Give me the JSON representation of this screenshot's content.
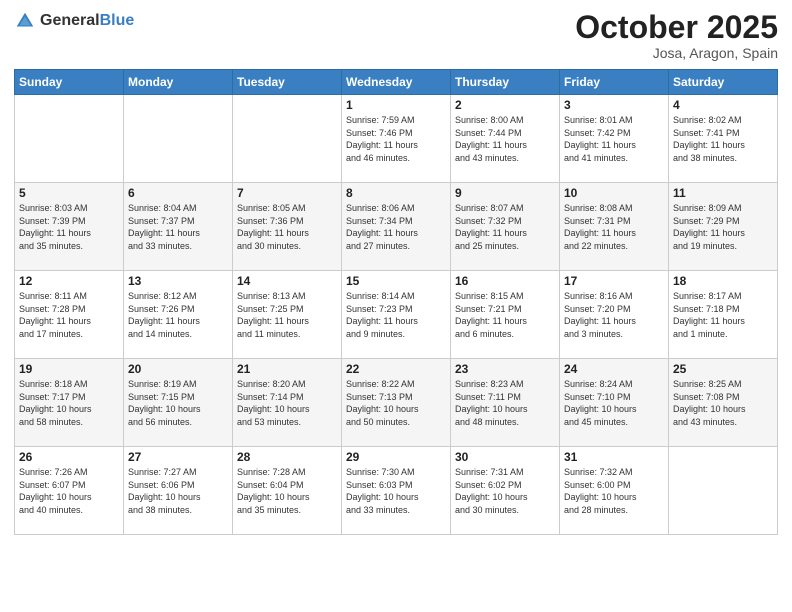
{
  "header": {
    "logo_general": "General",
    "logo_blue": "Blue",
    "month_title": "October 2025",
    "location": "Josa, Aragon, Spain"
  },
  "days_of_week": [
    "Sunday",
    "Monday",
    "Tuesday",
    "Wednesday",
    "Thursday",
    "Friday",
    "Saturday"
  ],
  "weeks": [
    [
      {
        "day": "",
        "info": ""
      },
      {
        "day": "",
        "info": ""
      },
      {
        "day": "",
        "info": ""
      },
      {
        "day": "1",
        "info": "Sunrise: 7:59 AM\nSunset: 7:46 PM\nDaylight: 11 hours\nand 46 minutes."
      },
      {
        "day": "2",
        "info": "Sunrise: 8:00 AM\nSunset: 7:44 PM\nDaylight: 11 hours\nand 43 minutes."
      },
      {
        "day": "3",
        "info": "Sunrise: 8:01 AM\nSunset: 7:42 PM\nDaylight: 11 hours\nand 41 minutes."
      },
      {
        "day": "4",
        "info": "Sunrise: 8:02 AM\nSunset: 7:41 PM\nDaylight: 11 hours\nand 38 minutes."
      }
    ],
    [
      {
        "day": "5",
        "info": "Sunrise: 8:03 AM\nSunset: 7:39 PM\nDaylight: 11 hours\nand 35 minutes."
      },
      {
        "day": "6",
        "info": "Sunrise: 8:04 AM\nSunset: 7:37 PM\nDaylight: 11 hours\nand 33 minutes."
      },
      {
        "day": "7",
        "info": "Sunrise: 8:05 AM\nSunset: 7:36 PM\nDaylight: 11 hours\nand 30 minutes."
      },
      {
        "day": "8",
        "info": "Sunrise: 8:06 AM\nSunset: 7:34 PM\nDaylight: 11 hours\nand 27 minutes."
      },
      {
        "day": "9",
        "info": "Sunrise: 8:07 AM\nSunset: 7:32 PM\nDaylight: 11 hours\nand 25 minutes."
      },
      {
        "day": "10",
        "info": "Sunrise: 8:08 AM\nSunset: 7:31 PM\nDaylight: 11 hours\nand 22 minutes."
      },
      {
        "day": "11",
        "info": "Sunrise: 8:09 AM\nSunset: 7:29 PM\nDaylight: 11 hours\nand 19 minutes."
      }
    ],
    [
      {
        "day": "12",
        "info": "Sunrise: 8:11 AM\nSunset: 7:28 PM\nDaylight: 11 hours\nand 17 minutes."
      },
      {
        "day": "13",
        "info": "Sunrise: 8:12 AM\nSunset: 7:26 PM\nDaylight: 11 hours\nand 14 minutes."
      },
      {
        "day": "14",
        "info": "Sunrise: 8:13 AM\nSunset: 7:25 PM\nDaylight: 11 hours\nand 11 minutes."
      },
      {
        "day": "15",
        "info": "Sunrise: 8:14 AM\nSunset: 7:23 PM\nDaylight: 11 hours\nand 9 minutes."
      },
      {
        "day": "16",
        "info": "Sunrise: 8:15 AM\nSunset: 7:21 PM\nDaylight: 11 hours\nand 6 minutes."
      },
      {
        "day": "17",
        "info": "Sunrise: 8:16 AM\nSunset: 7:20 PM\nDaylight: 11 hours\nand 3 minutes."
      },
      {
        "day": "18",
        "info": "Sunrise: 8:17 AM\nSunset: 7:18 PM\nDaylight: 11 hours\nand 1 minute."
      }
    ],
    [
      {
        "day": "19",
        "info": "Sunrise: 8:18 AM\nSunset: 7:17 PM\nDaylight: 10 hours\nand 58 minutes."
      },
      {
        "day": "20",
        "info": "Sunrise: 8:19 AM\nSunset: 7:15 PM\nDaylight: 10 hours\nand 56 minutes."
      },
      {
        "day": "21",
        "info": "Sunrise: 8:20 AM\nSunset: 7:14 PM\nDaylight: 10 hours\nand 53 minutes."
      },
      {
        "day": "22",
        "info": "Sunrise: 8:22 AM\nSunset: 7:13 PM\nDaylight: 10 hours\nand 50 minutes."
      },
      {
        "day": "23",
        "info": "Sunrise: 8:23 AM\nSunset: 7:11 PM\nDaylight: 10 hours\nand 48 minutes."
      },
      {
        "day": "24",
        "info": "Sunrise: 8:24 AM\nSunset: 7:10 PM\nDaylight: 10 hours\nand 45 minutes."
      },
      {
        "day": "25",
        "info": "Sunrise: 8:25 AM\nSunset: 7:08 PM\nDaylight: 10 hours\nand 43 minutes."
      }
    ],
    [
      {
        "day": "26",
        "info": "Sunrise: 7:26 AM\nSunset: 6:07 PM\nDaylight: 10 hours\nand 40 minutes."
      },
      {
        "day": "27",
        "info": "Sunrise: 7:27 AM\nSunset: 6:06 PM\nDaylight: 10 hours\nand 38 minutes."
      },
      {
        "day": "28",
        "info": "Sunrise: 7:28 AM\nSunset: 6:04 PM\nDaylight: 10 hours\nand 35 minutes."
      },
      {
        "day": "29",
        "info": "Sunrise: 7:30 AM\nSunset: 6:03 PM\nDaylight: 10 hours\nand 33 minutes."
      },
      {
        "day": "30",
        "info": "Sunrise: 7:31 AM\nSunset: 6:02 PM\nDaylight: 10 hours\nand 30 minutes."
      },
      {
        "day": "31",
        "info": "Sunrise: 7:32 AM\nSunset: 6:00 PM\nDaylight: 10 hours\nand 28 minutes."
      },
      {
        "day": "",
        "info": ""
      }
    ]
  ]
}
